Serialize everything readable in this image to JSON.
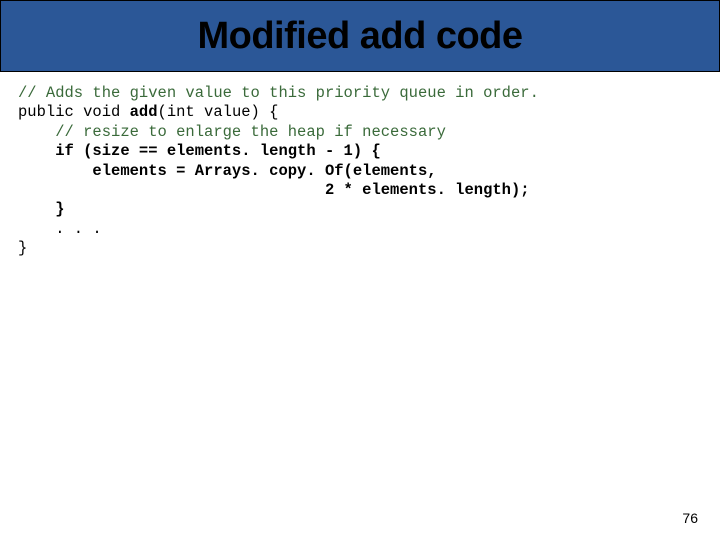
{
  "slide": {
    "title": "Modified add code",
    "page_number": "76"
  },
  "code": {
    "line1_comment": "// Adds the given value to this priority queue in order.",
    "line2_prefix": "public void ",
    "line2_method": "add",
    "line2_suffix": "(int value) {",
    "line3_comment": "    // resize to enlarge the heap if necessary",
    "line4_bold": "    if (size == elements. length - 1) {",
    "line5_bold": "        elements = Arrays. copy. Of(elements,",
    "line6_bold": "                                 2 * elements. length);",
    "line7_bold": "    }",
    "line8": "    . . .",
    "line9": "}"
  }
}
